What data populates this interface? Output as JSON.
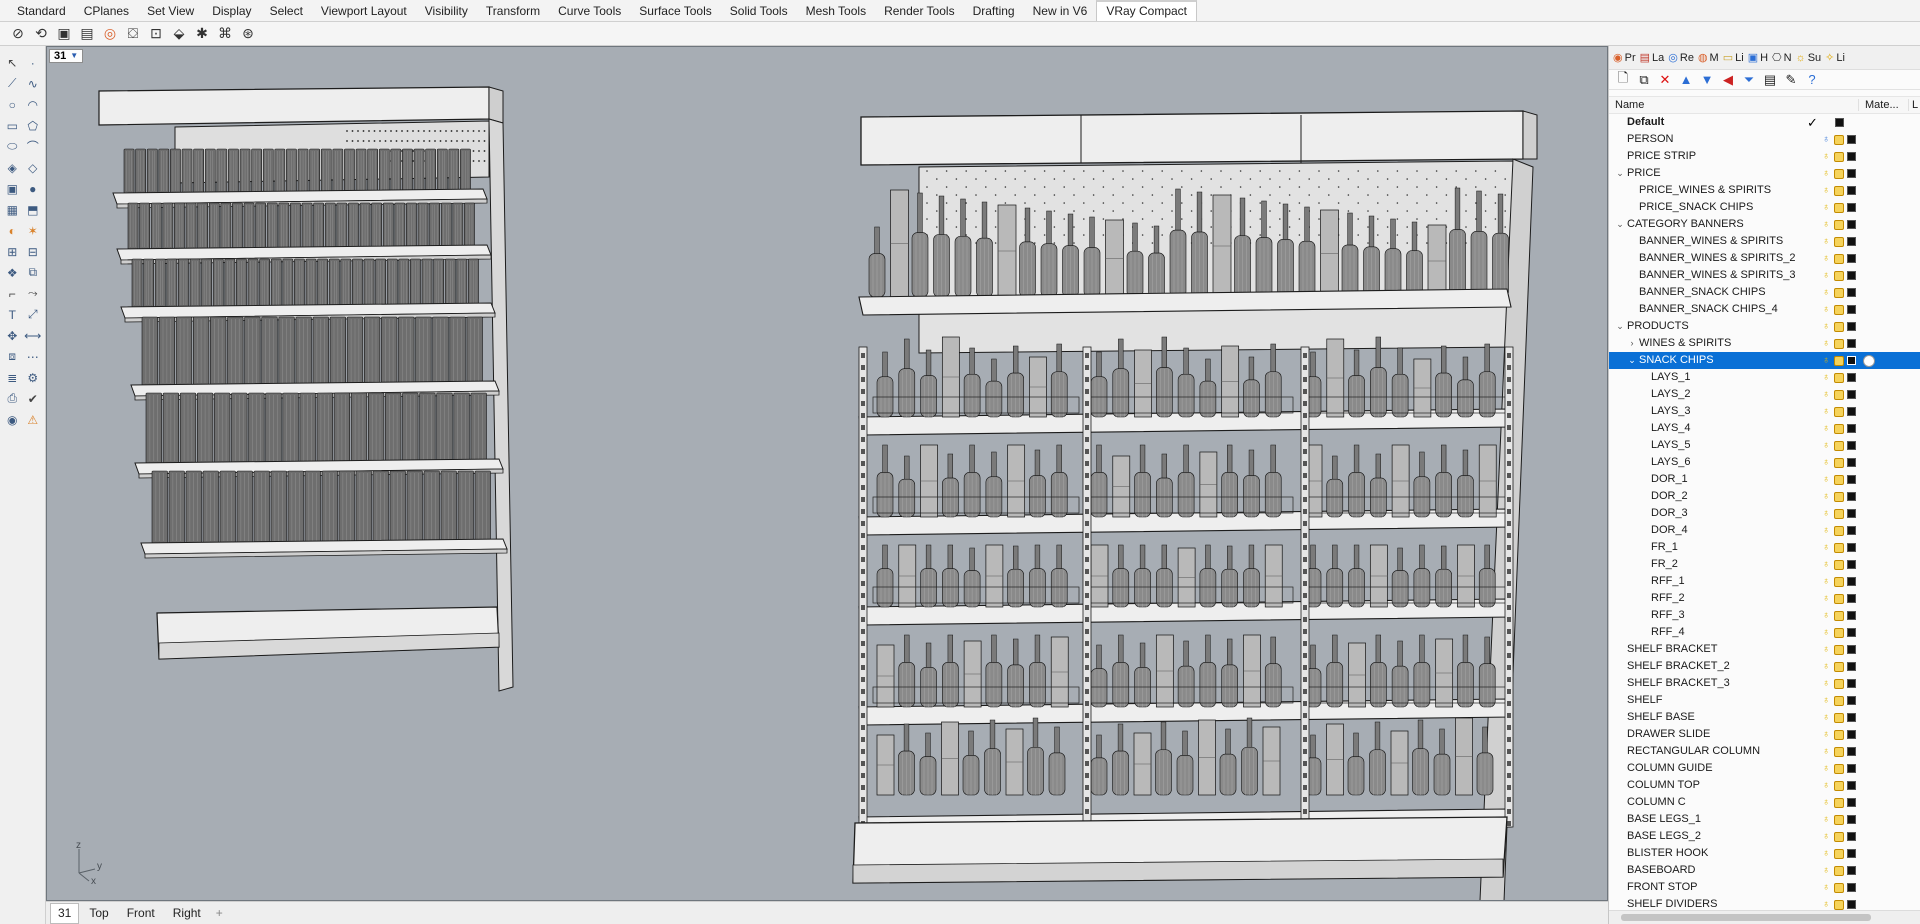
{
  "tabs": [
    {
      "label": "Standard",
      "active": false
    },
    {
      "label": "CPlanes",
      "active": false
    },
    {
      "label": "Set View",
      "active": false
    },
    {
      "label": "Display",
      "active": false
    },
    {
      "label": "Select",
      "active": false
    },
    {
      "label": "Viewport Layout",
      "active": false
    },
    {
      "label": "Visibility",
      "active": false
    },
    {
      "label": "Transform",
      "active": false
    },
    {
      "label": "Curve Tools",
      "active": false
    },
    {
      "label": "Surface Tools",
      "active": false
    },
    {
      "label": "Solid Tools",
      "active": false
    },
    {
      "label": "Mesh Tools",
      "active": false
    },
    {
      "label": "Render Tools",
      "active": false
    },
    {
      "label": "Drafting",
      "active": false
    },
    {
      "label": "New in V6",
      "active": false
    },
    {
      "label": "VRay Compact",
      "active": true
    }
  ],
  "viewport": {
    "title": "31",
    "axis_z": "z",
    "axis_y": "y",
    "axis_x": "x"
  },
  "viewport_tabs": [
    "31",
    "Top",
    "Front",
    "Right"
  ],
  "viewport_tab_add": "+",
  "panel": {
    "tabs": [
      {
        "icon": "properties-icon",
        "label": "Pr"
      },
      {
        "icon": "layers-icon",
        "label": "La"
      },
      {
        "icon": "render-icon",
        "label": "Re"
      },
      {
        "icon": "materials-icon",
        "label": "M"
      },
      {
        "icon": "libraries-icon",
        "label": "Li"
      },
      {
        "icon": "help-icon",
        "label": "H"
      },
      {
        "icon": "named-view-icon",
        "label": "N"
      },
      {
        "icon": "sun-icon",
        "label": "Su"
      },
      {
        "icon": "light-icon",
        "label": "Li"
      }
    ],
    "columns": {
      "name": "Name",
      "material": "Mate...",
      "linetype": "L"
    },
    "layers": [
      {
        "name": "Default",
        "level": 0,
        "bold": true,
        "current": true
      },
      {
        "name": "PERSON",
        "level": 0,
        "bulb": "blue"
      },
      {
        "name": "PRICE STRIP",
        "level": 0
      },
      {
        "name": "PRICE",
        "level": 0,
        "twisty": "v"
      },
      {
        "name": "PRICE_WINES & SPIRITS",
        "level": 1
      },
      {
        "name": "PRICE_SNACK CHIPS",
        "level": 1
      },
      {
        "name": "CATEGORY BANNERS",
        "level": 0,
        "twisty": "v"
      },
      {
        "name": "BANNER_WINES & SPIRITS",
        "level": 1
      },
      {
        "name": "BANNER_WINES & SPIRITS_2",
        "level": 1
      },
      {
        "name": "BANNER_WINES & SPIRITS_3",
        "level": 1
      },
      {
        "name": "BANNER_SNACK CHIPS",
        "level": 1
      },
      {
        "name": "BANNER_SNACK CHIPS_4",
        "level": 1
      },
      {
        "name": "PRODUCTS",
        "level": 0,
        "twisty": "v"
      },
      {
        "name": "WINES & SPIRITS",
        "level": 1,
        "twisty": ">"
      },
      {
        "name": "SNACK CHIPS",
        "level": 1,
        "twisty": "v",
        "selected": true
      },
      {
        "name": "LAYS_1",
        "level": 2
      },
      {
        "name": "LAYS_2",
        "level": 2
      },
      {
        "name": "LAYS_3",
        "level": 2
      },
      {
        "name": "LAYS_4",
        "level": 2
      },
      {
        "name": "LAYS_5",
        "level": 2
      },
      {
        "name": "LAYS_6",
        "level": 2
      },
      {
        "name": "DOR_1",
        "level": 2
      },
      {
        "name": "DOR_2",
        "level": 2
      },
      {
        "name": "DOR_3",
        "level": 2
      },
      {
        "name": "DOR_4",
        "level": 2
      },
      {
        "name": "FR_1",
        "level": 2
      },
      {
        "name": "FR_2",
        "level": 2
      },
      {
        "name": "RFF_1",
        "level": 2
      },
      {
        "name": "RFF_2",
        "level": 2
      },
      {
        "name": "RFF_3",
        "level": 2
      },
      {
        "name": "RFF_4",
        "level": 2
      },
      {
        "name": "SHELF BRACKET",
        "level": 0
      },
      {
        "name": "SHELF BRACKET_2",
        "level": 0
      },
      {
        "name": "SHELF BRACKET_3",
        "level": 0
      },
      {
        "name": "SHELF",
        "level": 0
      },
      {
        "name": "SHELF BASE",
        "level": 0
      },
      {
        "name": "DRAWER SLIDE",
        "level": 0
      },
      {
        "name": "RECTANGULAR COLUMN",
        "level": 0
      },
      {
        "name": "COLUMN GUIDE",
        "level": 0
      },
      {
        "name": "COLUMN TOP",
        "level": 0
      },
      {
        "name": "COLUMN C",
        "level": 0
      },
      {
        "name": "BASE LEGS_1",
        "level": 0
      },
      {
        "name": "BASE LEGS_2",
        "level": 0
      },
      {
        "name": "BLISTER HOOK",
        "level": 0
      },
      {
        "name": "BASEBOARD",
        "level": 0
      },
      {
        "name": "FRONT STOP",
        "level": 0
      },
      {
        "name": "SHELF DIVIDERS",
        "level": 0
      }
    ],
    "current_mark": "✓"
  },
  "colors": {
    "viewport_bg": "#a7adb4",
    "selection": "#0a70d6",
    "wire": "#1c1c1c",
    "shelf": "#eeeeee"
  }
}
